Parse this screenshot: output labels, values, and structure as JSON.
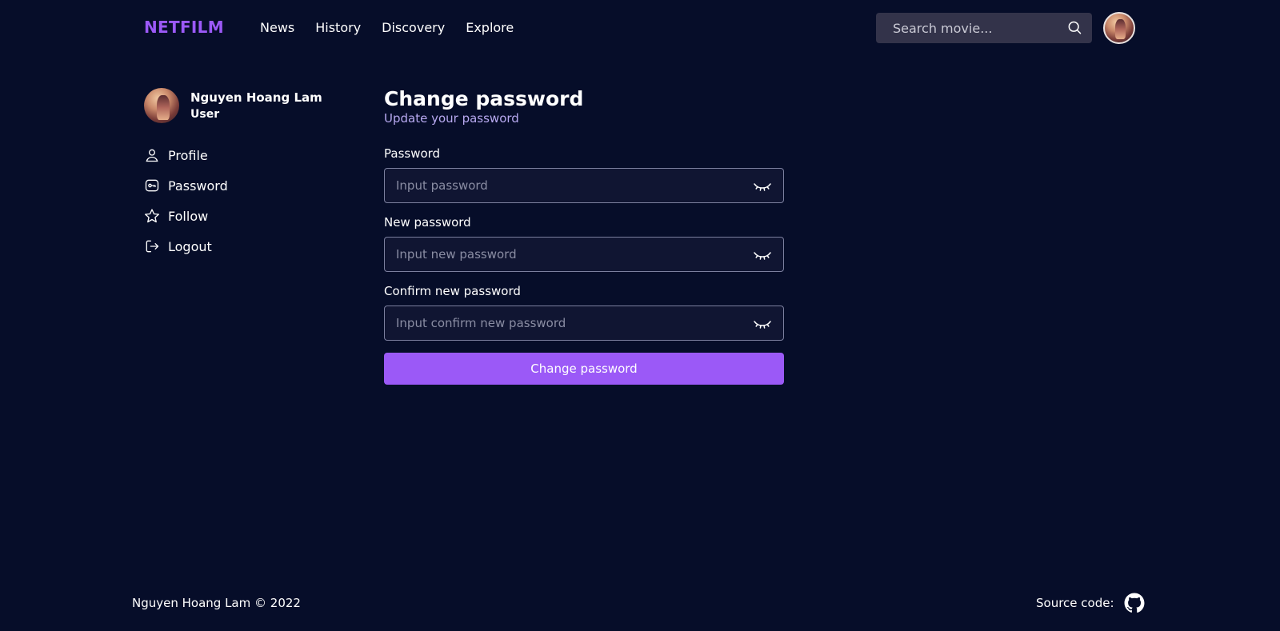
{
  "header": {
    "brand": "NETFILM",
    "nav": [
      "News",
      "History",
      "Discovery",
      "Explore"
    ],
    "search_placeholder": "Search movie..."
  },
  "sidebar": {
    "user_name": "Nguyen Hoang Lam",
    "user_role": "User",
    "items": [
      {
        "label": "Profile",
        "icon": "user-icon"
      },
      {
        "label": "Password",
        "icon": "key-icon"
      },
      {
        "label": "Follow",
        "icon": "star-icon"
      },
      {
        "label": "Logout",
        "icon": "logout-icon"
      }
    ]
  },
  "main": {
    "title": "Change password",
    "subtitle": "Update your password",
    "fields": [
      {
        "label": "Password",
        "placeholder": "Input password",
        "value": ""
      },
      {
        "label": "New password",
        "placeholder": "Input new password",
        "value": ""
      },
      {
        "label": "Confirm new password",
        "placeholder": "Input confirm new password",
        "value": ""
      }
    ],
    "submit_label": "Change password"
  },
  "footer": {
    "copyright": "Nguyen Hoang Lam © 2022",
    "source_label": "Source code:"
  },
  "colors": {
    "background": "#060d29",
    "accent": "#9b59f7",
    "subtitle": "#b7a9f0",
    "search_bg": "#33334a"
  }
}
